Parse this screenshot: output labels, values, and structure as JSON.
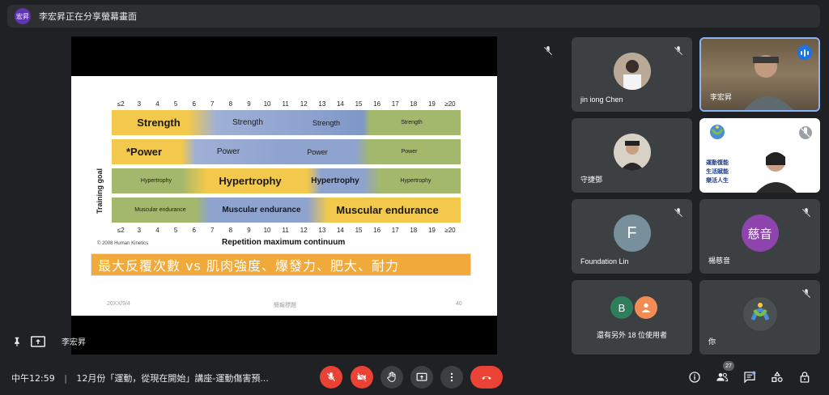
{
  "banner": {
    "avatar": "宏昇",
    "text": "李宏昇正在分享螢幕畫面"
  },
  "slide": {
    "y_label": "Training goal",
    "x_label": "Repetition maximum continuum",
    "ticks": [
      "≤2",
      "3",
      "4",
      "5",
      "6",
      "7",
      "8",
      "9",
      "10",
      "11",
      "12",
      "13",
      "14",
      "15",
      "16",
      "17",
      "18",
      "19",
      "≥20"
    ],
    "bands": {
      "strength": [
        "Strength",
        "Strength",
        "Strength",
        "Strength"
      ],
      "power": [
        "*Power",
        "Power",
        "Power",
        "Power"
      ],
      "hypertrophy": [
        "Hypertrophy",
        "Hypertrophy",
        "Hypertrophy",
        "Hypertrophy"
      ],
      "endurance": [
        "Muscular endurance",
        "Muscular endurance",
        "Muscular endurance"
      ]
    },
    "copyright": "© 2008 Human Kinetics",
    "caption": "最大反覆次數 vs 肌肉強度、爆發力、肥大、耐力",
    "footer_date": "20XX/9/4",
    "footer_center": "簡報標題",
    "footer_page": "40"
  },
  "presenter": {
    "name": "李宏昇"
  },
  "tiles": {
    "t1": "jin iong Chen",
    "t2": "李宏昇",
    "t3": "守捷鄧",
    "t4_lines": [
      "運動復能",
      "生活賦能",
      "樂活人生"
    ],
    "t5": "Foundation Lin",
    "t5_letter": "F",
    "t6": "楊慈音",
    "t6_letter": "慈音",
    "t7": "還有另外 18 位使用者",
    "t7_letter": "B",
    "t8": "你"
  },
  "bottom": {
    "time": "中午12:59",
    "separator": "|",
    "meeting": "12月份「運動，從現在開始」講座-運動傷害預...",
    "participants_count": "27"
  },
  "icons": [
    "mic-off-icon",
    "camera-off-icon",
    "raise-hand-icon",
    "present-icon",
    "more-icon",
    "end-call-icon",
    "info-icon",
    "people-icon",
    "chat-icon",
    "activities-icon",
    "host-controls-icon"
  ],
  "colors": {
    "end_call": "#ea4335",
    "tile_bg": "#3c4043",
    "band_yellow": "#f2c94c",
    "band_green": "#a3b86c",
    "band_blue": "#8fa3cf"
  }
}
